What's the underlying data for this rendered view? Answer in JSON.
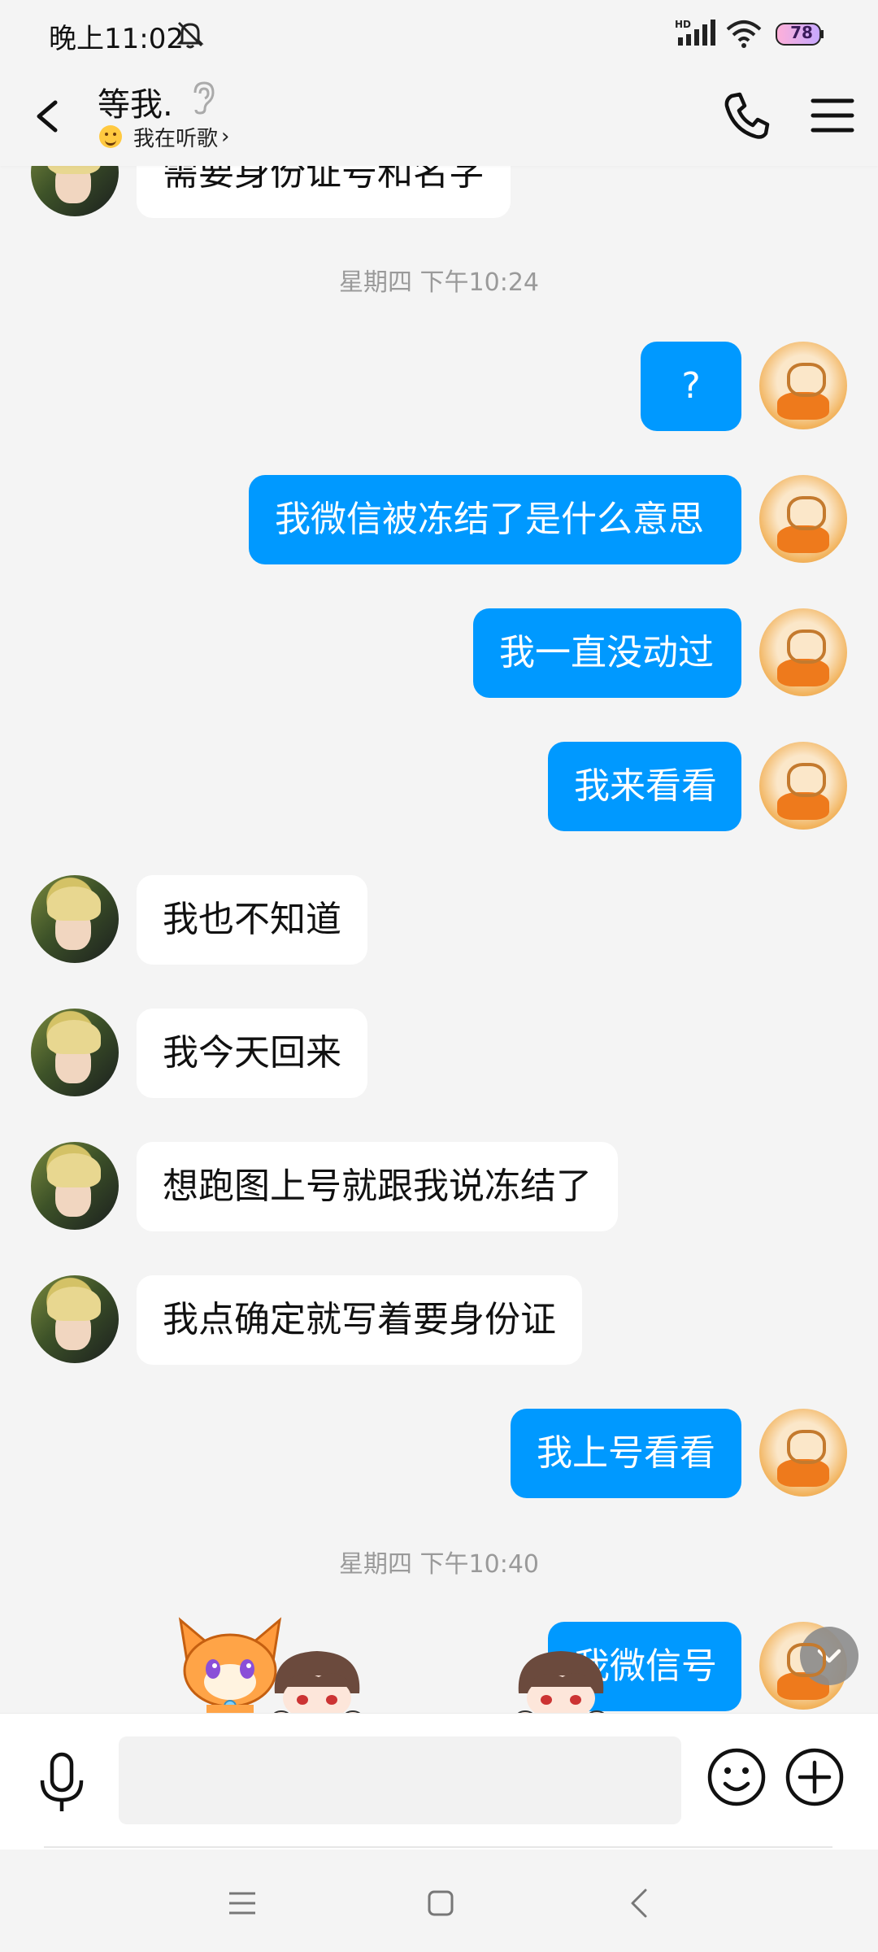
{
  "status_bar": {
    "time": "晚上11:02",
    "battery": "78",
    "network": "HD"
  },
  "header": {
    "contact_name": "等我.",
    "status_text": "我在听歌",
    "status_chevron": "›"
  },
  "messages": [
    {
      "side": "other",
      "text": "需要身份证号和名字"
    },
    {
      "type": "time",
      "text": "星期四 下午10:24"
    },
    {
      "side": "me",
      "text": "?"
    },
    {
      "side": "me",
      "text": "我微信被冻结了是什么意思"
    },
    {
      "side": "me",
      "text": "我一直没动过"
    },
    {
      "side": "me",
      "text": "我来看看"
    },
    {
      "side": "other",
      "text": "我也不知道"
    },
    {
      "side": "other",
      "text": "我今天回来"
    },
    {
      "side": "other",
      "text": "想跑图上号就跟我说冻结了"
    },
    {
      "side": "other",
      "text": "我点确定就写着要身份证"
    },
    {
      "side": "me",
      "text": "我上号看看"
    },
    {
      "type": "time",
      "text": "星期四 下午10:40"
    },
    {
      "side": "me",
      "text": "我微信号"
    }
  ],
  "input": {
    "value": "",
    "placeholder": ""
  },
  "icons": {
    "bell": "bell-off-icon",
    "ear": "ear-icon",
    "phone": "phone-icon",
    "menu": "menu-icon",
    "mic": "microphone-icon",
    "emoji": "emoji-icon",
    "plus": "plus-icon"
  },
  "colors": {
    "my_bubble": "#0099ff",
    "other_bubble": "#ffffff",
    "background": "#f4f4f4"
  }
}
